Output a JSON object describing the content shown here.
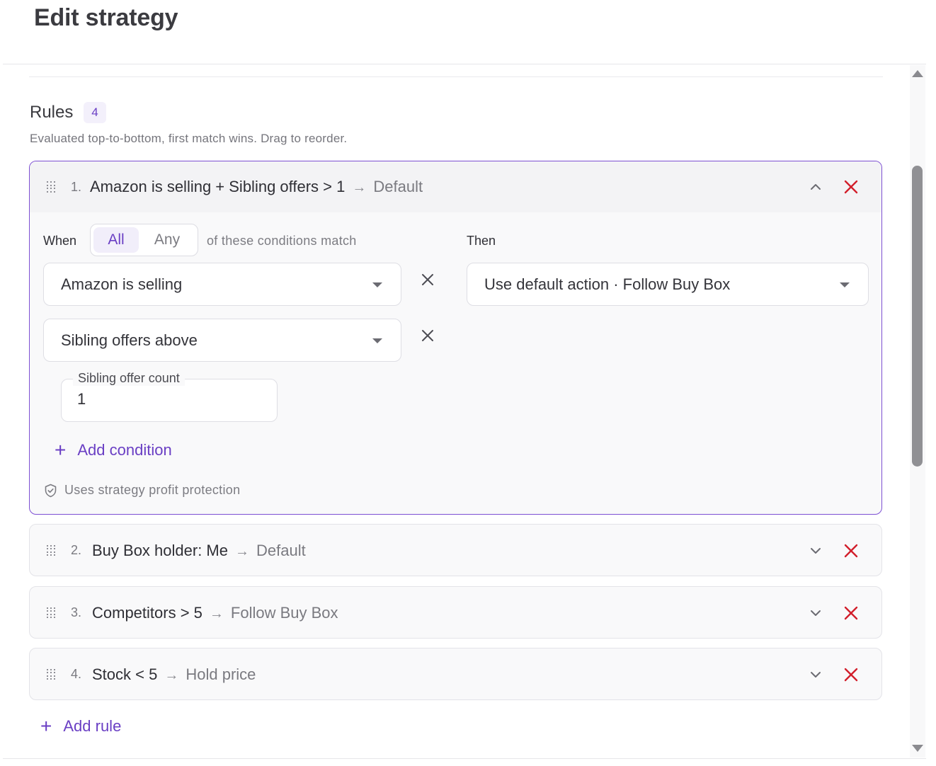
{
  "page": {
    "title": "Edit strategy"
  },
  "rules_section": {
    "title": "Rules",
    "count": "4",
    "description": "Evaluated top-to-bottom, first match wins. Drag to reorder."
  },
  "rules": [
    {
      "number": "1.",
      "condition": "Amazon is selling + Sibling offers > 1",
      "arrow": "→",
      "action": "Default",
      "expanded": true
    },
    {
      "number": "2.",
      "condition": "Buy Box holder: Me",
      "arrow": "→",
      "action": "Default",
      "expanded": false
    },
    {
      "number": "3.",
      "condition": "Competitors > 5",
      "arrow": "→",
      "action": "Follow Buy Box",
      "expanded": false
    },
    {
      "number": "4.",
      "condition": "Stock < 5",
      "arrow": "→",
      "action": "Hold price",
      "expanded": false
    }
  ],
  "rule_editor": {
    "when_label": "When",
    "match_options": [
      "All",
      "Any"
    ],
    "selected_match": "All",
    "match_suffix": "of these conditions match",
    "then_label": "Then",
    "conditions": [
      "Amazon is selling",
      "Sibling offers above"
    ],
    "sibling_count_label": "Sibling offer count",
    "sibling_count_value": "1",
    "add_condition_label": "Add condition",
    "then_action": "Use default action · Follow Buy Box",
    "protection_note": "Uses strategy profit protection"
  },
  "add_rule_label": "Add rule",
  "colors": {
    "accent": "#6a3fc4",
    "delete": "#d21f2b",
    "expanded_border": "#7d4fd3"
  }
}
